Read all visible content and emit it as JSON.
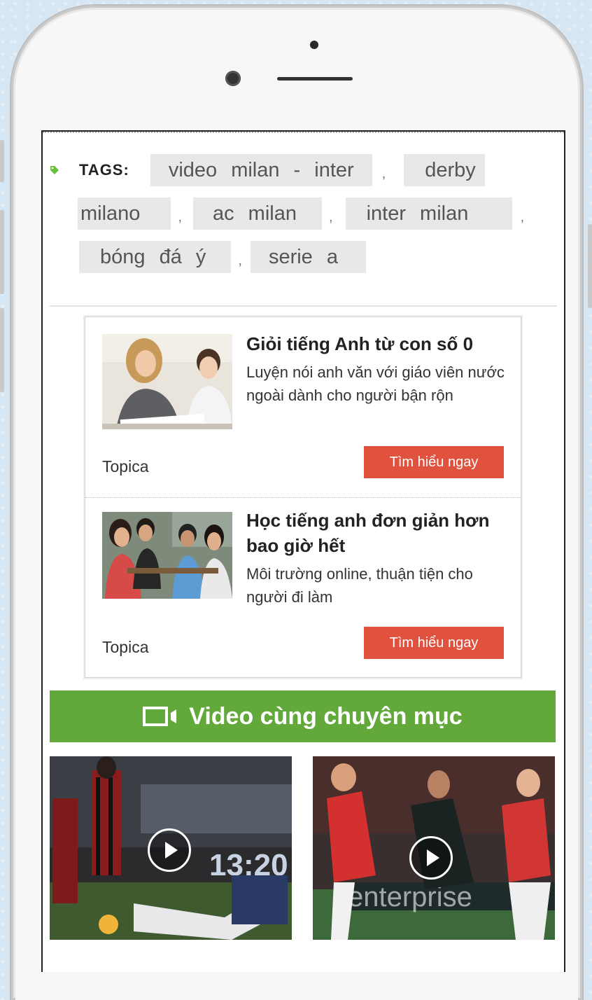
{
  "tags": {
    "label": "TAGS:",
    "separator": ",",
    "items": [
      "video milan - inter",
      "derby milano",
      "ac milan",
      "inter milan",
      "bóng đá ý",
      "serie a"
    ],
    "icon": "tag-icon",
    "icon_color": "#6abf3c"
  },
  "ads": [
    {
      "title": "Giỏi tiếng Anh từ con số 0",
      "description": "Luyện nói anh văn với giáo viên nước ngoài dành cho người bận rộn",
      "brand": "Topica",
      "cta": "Tìm hiểu ngay"
    },
    {
      "title": "Học tiếng anh đơn giản hơn bao giờ hết",
      "description": "Môi trường online, thuận tiện cho người đi làm",
      "brand": "Topica",
      "cta": "Tìm hiểu ngay"
    }
  ],
  "videos": {
    "heading": "Video cùng chuyên mục",
    "heading_icon": "video-camera-icon",
    "items": [
      {
        "scoreboard_text": "13:20",
        "play_icon": "play-icon"
      },
      {
        "sponsor_text": "enterprise",
        "play_icon": "play-icon"
      }
    ]
  },
  "colors": {
    "accent_green": "#62a83a",
    "cta_red": "#e0523e",
    "tag_bg": "#e8e8e8"
  }
}
